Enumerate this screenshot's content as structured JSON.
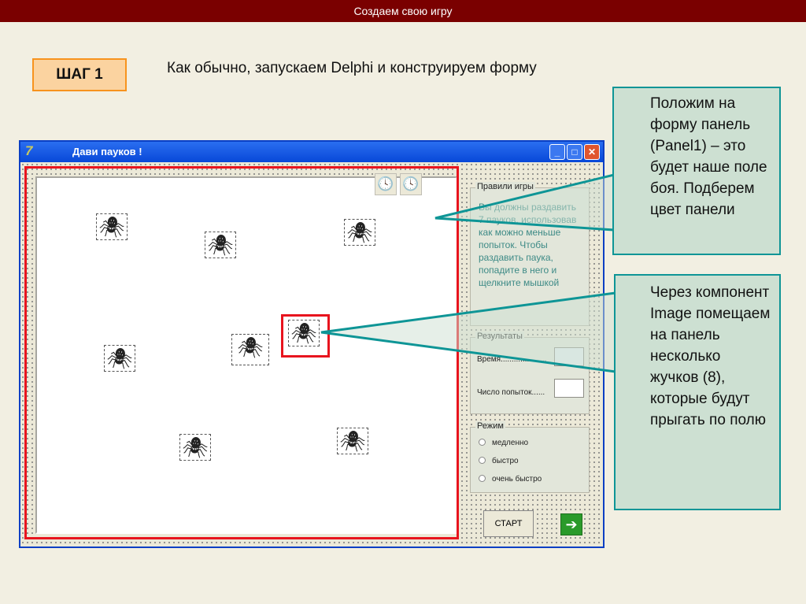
{
  "slide": {
    "title": "Создаем свою игру",
    "step": "ШАГ 1",
    "heading": "Как обычно, запускаем Delphi и конструируем форму"
  },
  "window": {
    "title": "Дави пауков !",
    "logo": "7",
    "icons": [
      "minimize-icon",
      "maximize-icon",
      "close-icon"
    ]
  },
  "rules": {
    "label": "Правили игры",
    "text": "Вы должны раздавить 7 пауков, использовав как можно меньше попыток. Чтобы раздавить паука, попадите в него и щелкните мышкой"
  },
  "results": {
    "label": "Результаты",
    "time_label": "Время.....................",
    "tries_label": "Число попыток......"
  },
  "mode": {
    "label": "Режим",
    "options": [
      "медленно",
      "быстро",
      "очень быстро"
    ]
  },
  "buttons": {
    "start": "СТАРТ",
    "exit_icon": "green-arrow-icon"
  },
  "callouts": {
    "panel": "Положим на форму панель (Panel1) – это будет наше поле боя. Подберем цвет панели",
    "image": "Через компонент Image помещаем на панель несколько жучков (8), которые будут прыгать по полю"
  },
  "spiders": [
    "🕷",
    "🕷",
    "🕷",
    "🕷",
    "🕷",
    "🕷",
    "🕷",
    "🕷"
  ],
  "colors": {
    "topbar": "#7a0000",
    "highlight": "#e8141e",
    "callout_border": "#0e9596",
    "callout_bg": "#cde0d2"
  }
}
